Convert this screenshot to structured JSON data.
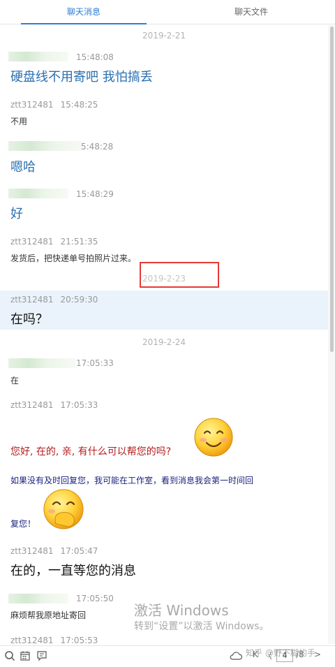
{
  "tabs": {
    "messages": "聊天消息",
    "files": "聊天文件"
  },
  "dates": {
    "d1": "2019-2-21",
    "d2": "2019-2-23",
    "d3": "2019-2-24"
  },
  "messages": [
    {
      "sender": "",
      "time": "15:48:08",
      "text": "硬盘线不用寄吧 我怕搞丢"
    },
    {
      "sender": "ztt312481",
      "time": "15:48:25",
      "text": "不用"
    },
    {
      "sender": "",
      "time": "5:48:28",
      "text": "嗯哈"
    },
    {
      "sender": "",
      "time": "15:48:29",
      "text": "好"
    },
    {
      "sender": "ztt312481",
      "time": "21:51:35",
      "text": "发货后，把快递单号拍照片过来。"
    },
    {
      "sender": "ztt312481",
      "time": "20:59:30",
      "text": "在吗？"
    },
    {
      "sender": "",
      "time": "17:05:33",
      "text": "在"
    },
    {
      "sender": "ztt312481",
      "time": "17:05:33",
      "text": "您好, 在的, 亲, 有什么可以帮您的吗?"
    },
    {
      "sender": "",
      "time": "",
      "text": "如果没有及时回复您，我可能在工作室，看到消息我会第一时间回"
    },
    {
      "sender": "",
      "time": "",
      "text": "复您！"
    },
    {
      "sender": "ztt312481",
      "time": "17:05:47",
      "text": "在的，一直等您的消息"
    },
    {
      "sender": "",
      "time": "17:05:50",
      "text": "麻烦帮我原地址寄回"
    },
    {
      "sender": "ztt312481",
      "time": "17:05:53",
      "text": ""
    }
  ],
  "watermark": {
    "line1": "激活 Windows",
    "line2": "转到“设置”以激活 Windows。"
  },
  "toolbar": {
    "page_current": "4",
    "page_total": "/8",
    "prev": "〈",
    "first": "K",
    "next": ">"
  },
  "credit": "知乎 @野不糊的手",
  "colors": {
    "accent": "#2c7ed6",
    "highlight_row": "#eaf3fb",
    "annotation_box": "#e53935"
  }
}
